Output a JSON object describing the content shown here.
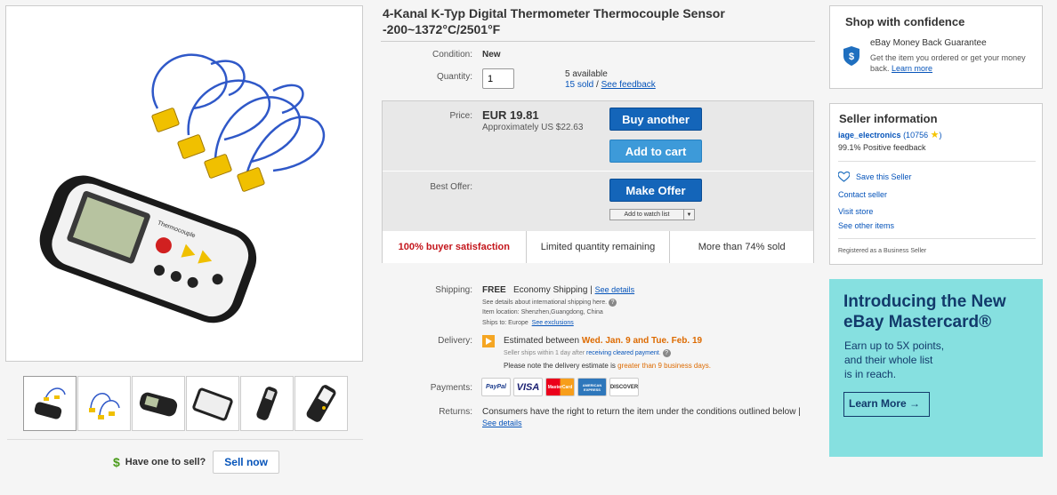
{
  "title": "4-Kanal K-Typ Digital Thermometer Thermocouple Sensor -200~1372°C/2501°F",
  "condition": {
    "label": "Condition:",
    "value": "New"
  },
  "quantity": {
    "label": "Quantity:",
    "value": "1",
    "available": "5 available",
    "sold": "15 sold",
    "sep": " / ",
    "feedback_link": "See feedback"
  },
  "price": {
    "label": "Price:",
    "value": "EUR 19.81",
    "approx": "Approximately US $22.63"
  },
  "buttons": {
    "buy": "Buy another",
    "cart": "Add to cart",
    "offer": "Make Offer",
    "watch": "Add to watch list",
    "watch_arrow": "▼"
  },
  "best_offer_label": "Best Offer:",
  "stats": [
    "100% buyer satisfaction",
    "Limited quantity remaining",
    "More than 74% sold"
  ],
  "shipping": {
    "label": "Shipping:",
    "free": "FREE",
    "method": "Economy Shipping",
    "sep": "|",
    "details_link": "See details",
    "intl": "See details about international shipping here.",
    "location": "Item location:  Shenzhen,Guangdong, China",
    "ships_to": "Ships to:   Europe",
    "exclusions_link": "See exclusions"
  },
  "delivery": {
    "label": "Delivery:",
    "prefix": "Estimated between",
    "dates": "Wed. Jan. 9 and Tue. Feb. 19",
    "seller_ships": "Seller ships within 1 day after",
    "cleared_link": "receiving cleared payment",
    "cleared_suffix": ".",
    "note_prefix": "Please note the delivery estimate is",
    "note_highlight": "greater than 9 business days."
  },
  "payments": {
    "label": "Payments:",
    "logos": [
      "PayPal",
      "VISA",
      "MasterCard",
      "AMERICAN EXPRESS",
      "DISCOVER"
    ]
  },
  "returns": {
    "label": "Returns:",
    "text": "Consumers have the right to return the item under the conditions outlined below |",
    "link": "See details"
  },
  "sell": {
    "text": "Have one to sell?",
    "button": "Sell now"
  },
  "confidence": {
    "title": "Shop with confidence",
    "guarantee": "eBay Money Back Guarantee",
    "desc": "Get the item you ordered or get your money back.",
    "learn_more": "Learn more"
  },
  "seller": {
    "title": "Seller information",
    "name": "iage_electronics",
    "score": "(10756",
    "score_close": ")",
    "feedback": "99.1% Positive feedback",
    "save": "Save this Seller",
    "contact": "Contact seller",
    "store": "Visit store",
    "other": "See other items",
    "registered": "Registered as a Business Seller"
  },
  "ad": {
    "title_line1": "Introducing the New",
    "title_line2": "eBay Mastercard®",
    "text_line1": "Earn up to 5X points,",
    "text_line2": "and their whole list",
    "text_line3": "is in reach.",
    "button": "Learn More",
    "button_arrow": "→"
  },
  "colors": {
    "buy_button": "#1465b9",
    "cart_button": "#3d9ad9",
    "red_stat": "#c4161c",
    "ad_bg": "#86e0e0",
    "ad_text": "#123a6b",
    "delivery_dates": "#dd6a00"
  }
}
